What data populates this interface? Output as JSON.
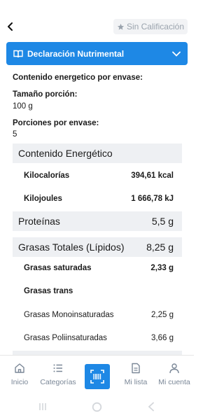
{
  "header": {
    "rating_label": "Sin Calificación"
  },
  "accordion": {
    "title": "Declaración Nutrimental"
  },
  "info": {
    "energy_per_container": "Contenido energetico por envase:",
    "portion_label": "Tamaño porción:",
    "portion_value": "100 g",
    "portions_label": "Porciones por envase:",
    "portions_value": "5"
  },
  "table": {
    "energy_header": "Contenido Energético",
    "kcal_label": "Kilocalorías",
    "kcal_value": "394,61 kcal",
    "kj_label": "Kilojoules",
    "kj_value": "1 666,78 kJ",
    "protein_label": "Proteínas",
    "protein_value": "5,5 g",
    "fat_label": "Grasas Totales (Lípidos)",
    "fat_value": "8,25 g",
    "sat_label": "Grasas saturadas",
    "sat_value": "2,33 g",
    "trans_label": "Grasas trans",
    "mono_label": "Grasas Monoinsaturadas",
    "mono_value": "2,25 g",
    "poly_label": "Grasas Poliinsaturadas",
    "poly_value": "3,66 g"
  },
  "nav": {
    "home": "Inicio",
    "categories": "Categorías",
    "my_list": "Mi lista",
    "my_account": "Mi cuenta"
  },
  "colors": {
    "accent": "#1e88e5",
    "nav_text": "#7a8797",
    "row_shade": "#eef0f3"
  }
}
